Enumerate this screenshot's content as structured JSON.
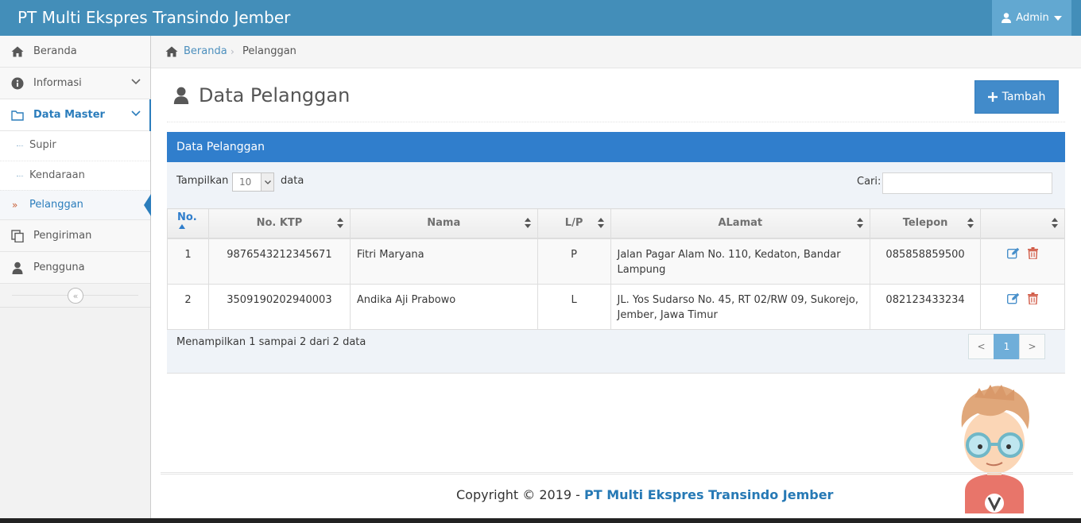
{
  "navbar": {
    "brand": "PT Multi Ekspres Transindo Jember",
    "user": "Admin"
  },
  "sidebar": {
    "items": [
      {
        "label": "Beranda",
        "icon": "home-icon"
      },
      {
        "label": "Informasi",
        "icon": "info-icon"
      },
      {
        "label": "Data Master",
        "icon": "folder-icon"
      },
      {
        "label": "Pengiriman",
        "icon": "copy-icon"
      },
      {
        "label": "Pengguna",
        "icon": "user-icon"
      }
    ],
    "submenu": [
      "Supir",
      "Kendaraan",
      "Pelanggan"
    ],
    "active_sub": "Pelanggan"
  },
  "breadcrumb": {
    "home": "Beranda",
    "current": "Pelanggan"
  },
  "page": {
    "title": "Data Pelanggan",
    "add_button": "Tambah"
  },
  "widget": {
    "title": "Data Pelanggan",
    "length_label": "Tampilkan",
    "length_value": "10",
    "length_suffix": "data",
    "search_label": "Cari:",
    "columns": [
      "No.",
      "No. KTP",
      "Nama",
      "L/P",
      "ALamat",
      "Telepon",
      ""
    ],
    "rows": [
      {
        "no": "1",
        "ktp": "9876543212345671",
        "nama": "Fitri Maryana",
        "lp": "P",
        "alamat": "Jalan Pagar Alam No. 110, Kedaton, Bandar Lampung",
        "telepon": "085858859500"
      },
      {
        "no": "2",
        "ktp": "3509190202940003",
        "nama": "Andika Aji Prabowo",
        "lp": "L",
        "alamat": "JL. Yos Sudarso No. 45, RT 02/RW 09, Sukorejo, Jember, Jawa Timur",
        "telepon": "082123433234"
      }
    ],
    "info": "Menampilkan 1 sampai 2 dari 2 data",
    "pager": {
      "prev": "<",
      "current": "1",
      "next": ">"
    }
  },
  "footer": {
    "prefix": "Copyright © 2019 - ",
    "brand": "PT Multi Ekspres Transindo Jember"
  },
  "colors": {
    "navbar": "#438eb9",
    "accent": "#307ecc",
    "danger": "#d15b47"
  }
}
